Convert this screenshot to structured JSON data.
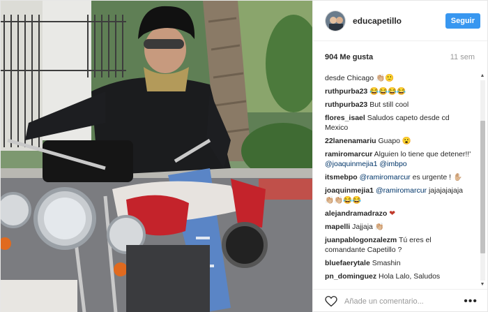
{
  "post": {
    "username": "educapetillo",
    "follow_label": "Seguir",
    "likes": "904 Me gusta",
    "time": "11 sem",
    "comment_placeholder": "Añade un comentario...",
    "more": "•••"
  },
  "comments": [
    {
      "user": "",
      "text": "desde Chicago 👏🏼🙂"
    },
    {
      "user": "ruthpurba23",
      "text": "😂😂😂😂"
    },
    {
      "user": "ruthpurba23",
      "text": "But still cool"
    },
    {
      "user": "flores_isael",
      "text": "Saludos capeto desde cd Mexico"
    },
    {
      "user": "22lanenamariu",
      "text": "Guapo 😮"
    },
    {
      "user": "ramiromarcur",
      "text": "Alguien lo tiene que detener!!' ",
      "m1": "@joaquinmejia1",
      "m2": "@imbpo"
    },
    {
      "user": "itsmebpo",
      "text": " es urgente ! ✋🏼",
      "m1": "@ramiromarcur"
    },
    {
      "user": "joaquinmejia1",
      "text": " jajajajajaja 👏🏼👏🏼😂😂",
      "m1": "@ramiromarcur"
    },
    {
      "user": "alejandramadrazo",
      "text": "❤"
    },
    {
      "user": "mapelli",
      "text": "Jajjaja 👏🏼"
    },
    {
      "user": "juanpablogonzalezm",
      "text": "Tú eres el comandante Capetillo ?"
    },
    {
      "user": "bluefaerytale",
      "text": "Smashin"
    },
    {
      "user": "pn_dominguez",
      "text": "Hola Lalo, Saludos"
    }
  ],
  "scrollbar": {
    "up": "▲",
    "down": "▼"
  }
}
